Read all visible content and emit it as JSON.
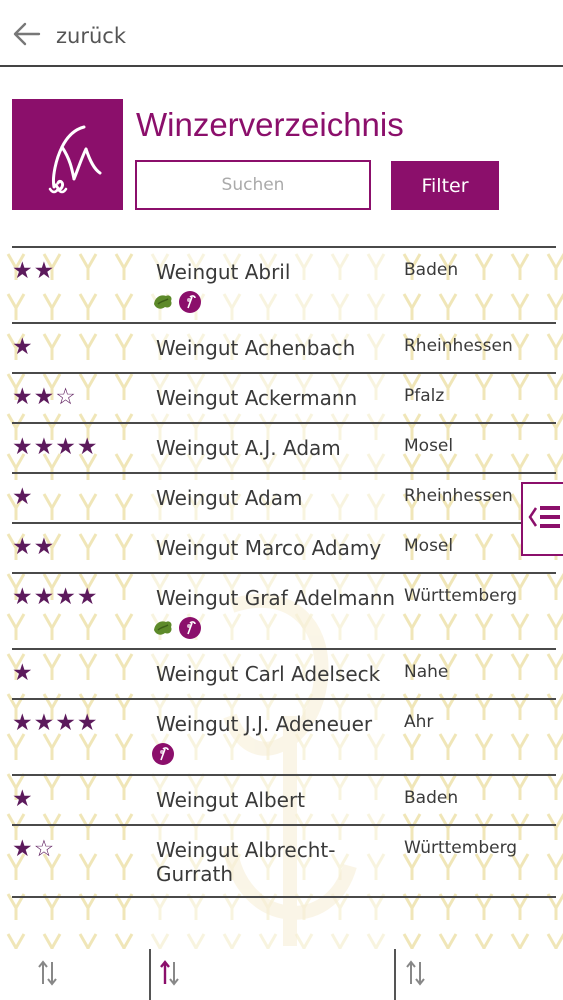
{
  "nav": {
    "back_label": "zurück"
  },
  "header": {
    "title": "Winzerverzeichnis"
  },
  "search": {
    "placeholder": "Suchen"
  },
  "filter": {
    "label": "Filter"
  },
  "colors": {
    "brand": "#8b0f6b",
    "star": "#5c1a5c",
    "divider": "#4a4a4a"
  },
  "wineries": [
    {
      "name": "Weingut Abril",
      "region": "Baden",
      "stars": "★★",
      "badges": [
        "organic-icon",
        "grape-icon"
      ]
    },
    {
      "name": "Weingut Achenbach",
      "region": "Rheinhessen",
      "stars": "★",
      "badges": []
    },
    {
      "name": "Weingut Ackermann",
      "region": "Pfalz",
      "stars": "★★☆",
      "badges": []
    },
    {
      "name": "Weingut A.J. Adam",
      "region": "Mosel",
      "stars": "★★★★",
      "badges": []
    },
    {
      "name": "Weingut Adam",
      "region": "Rheinhessen",
      "stars": "★",
      "badges": []
    },
    {
      "name": "Weingut Marco Adamy",
      "region": "Mosel",
      "stars": "★★",
      "badges": []
    },
    {
      "name": "Weingut Graf Adelmann",
      "region": "Württemberg",
      "stars": "★★★★",
      "badges": [
        "organic-icon",
        "grape-icon"
      ]
    },
    {
      "name": "Weingut Carl Adelseck",
      "region": "Nahe",
      "stars": "★",
      "badges": []
    },
    {
      "name": "Weingut J.J. Adeneuer",
      "region": "Ahr",
      "stars": "★★★★",
      "badges": [
        "grape-icon"
      ]
    },
    {
      "name": "Weingut Albert",
      "region": "Baden",
      "stars": "★",
      "badges": []
    },
    {
      "name": "Weingut Albrecht-Gurrath",
      "region": "Württemberg",
      "stars": "★☆",
      "badges": []
    }
  ],
  "bottom": {
    "active_sort": "name"
  }
}
